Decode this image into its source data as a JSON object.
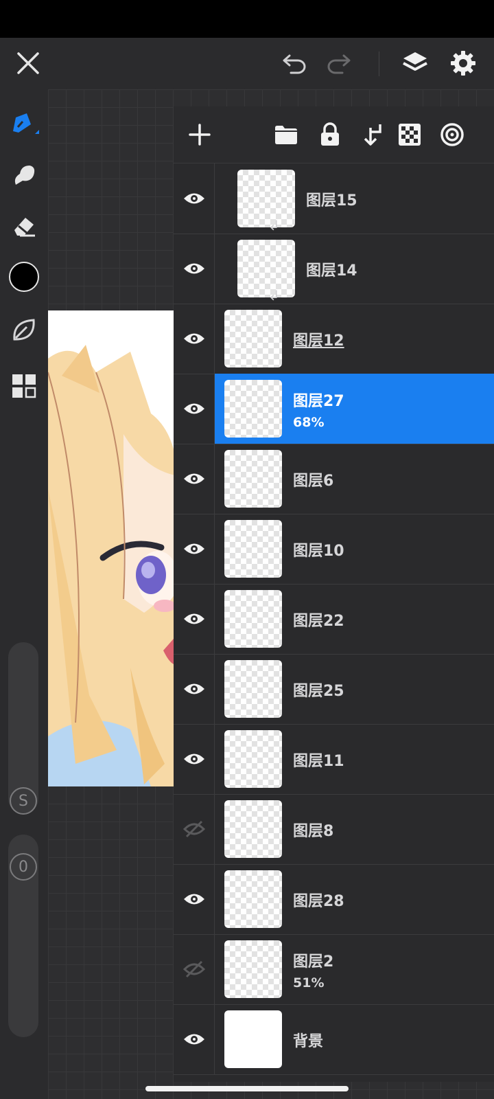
{
  "layers": [
    {
      "name": "图层15",
      "opacity": "",
      "visible": true,
      "clipped": true,
      "underline": false
    },
    {
      "name": "图层14",
      "opacity": "",
      "visible": true,
      "clipped": true,
      "underline": false
    },
    {
      "name": "图层12",
      "opacity": "",
      "visible": true,
      "clipped": false,
      "underline": true
    },
    {
      "name": "图层27",
      "opacity": "68%",
      "visible": true,
      "clipped": false,
      "underline": false,
      "selected": true
    },
    {
      "name": "图层6",
      "opacity": "",
      "visible": true,
      "clipped": false,
      "underline": false
    },
    {
      "name": "图层10",
      "opacity": "",
      "visible": true,
      "clipped": false,
      "underline": false
    },
    {
      "name": "图层22",
      "opacity": "",
      "visible": true,
      "clipped": false,
      "underline": false
    },
    {
      "name": "图层25",
      "opacity": "",
      "visible": true,
      "clipped": false,
      "underline": false
    },
    {
      "name": "图层11",
      "opacity": "",
      "visible": true,
      "clipped": false,
      "underline": false
    },
    {
      "name": "图层8",
      "opacity": "",
      "visible": false,
      "clipped": false,
      "underline": false
    },
    {
      "name": "图层28",
      "opacity": "",
      "visible": true,
      "clipped": false,
      "underline": false
    },
    {
      "name": "图层2",
      "opacity": "51%",
      "visible": false,
      "clipped": false,
      "underline": false
    },
    {
      "name": "背景",
      "opacity": "",
      "visible": true,
      "clipped": false,
      "underline": false
    }
  ],
  "left_toolbar": {
    "stabilizer_label": "S",
    "opacity_label": "0",
    "current_color": "#000000"
  },
  "colors": {
    "accent": "#1a7ff0",
    "panel": "#2a2a2c",
    "toolbar": "#2b2b2d"
  }
}
